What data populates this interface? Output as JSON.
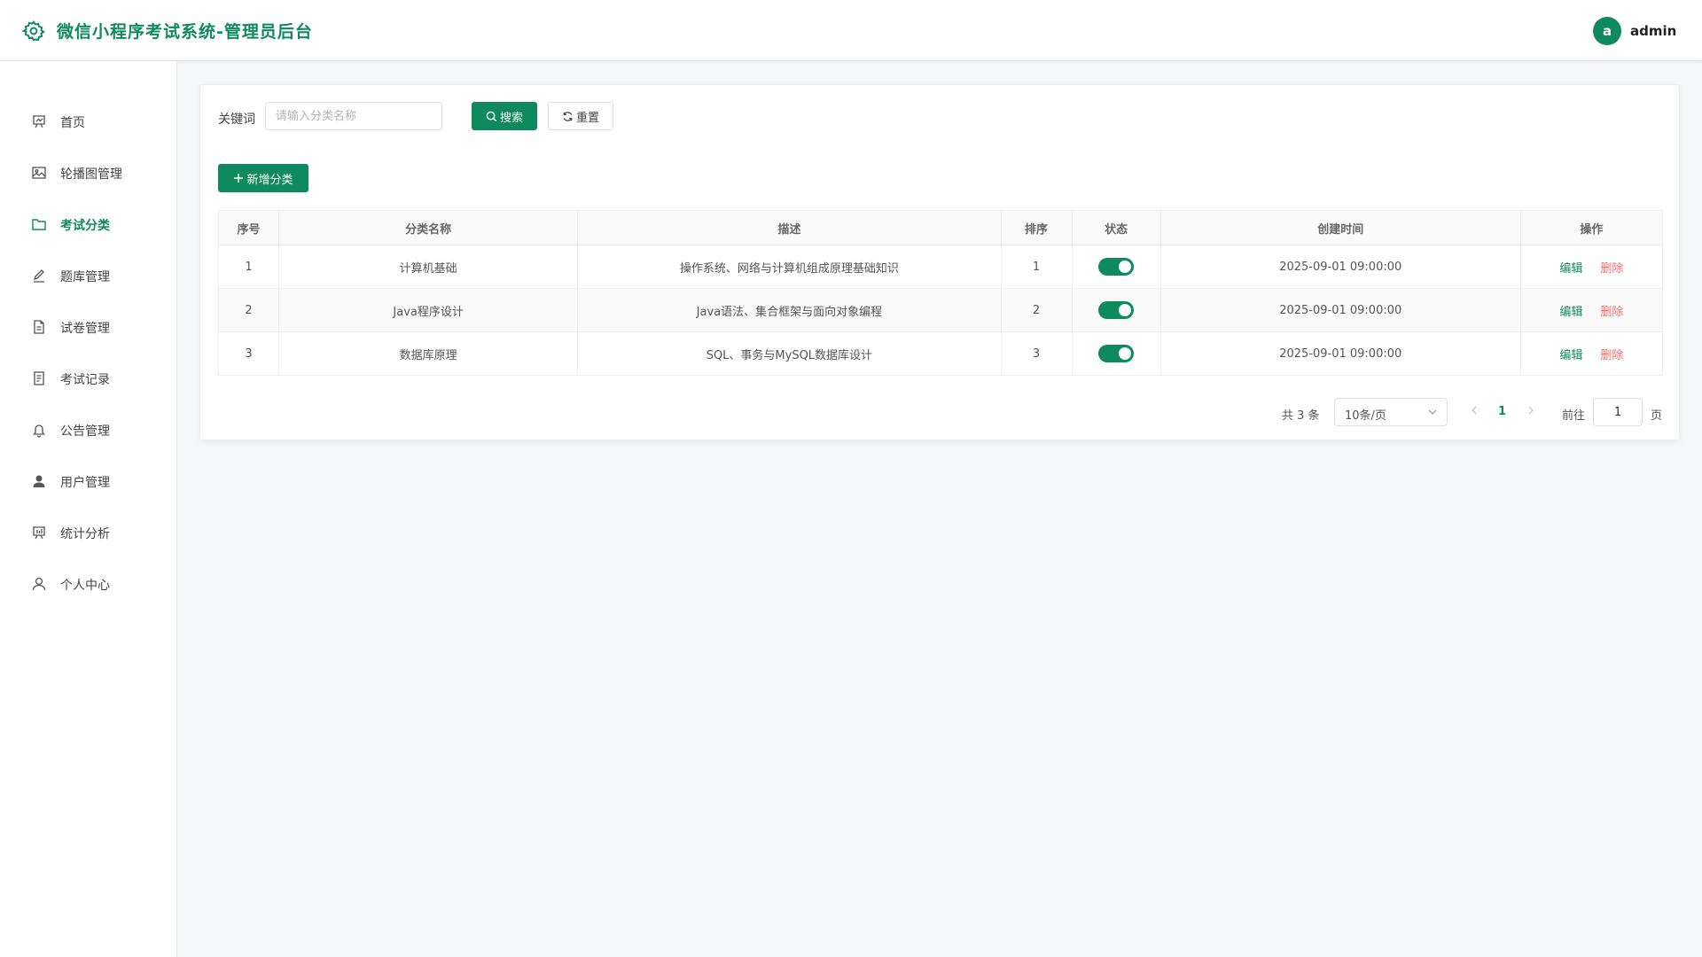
{
  "app": {
    "title": "微信小程序考试系统-管理员后台",
    "user_avatar_letter": "a",
    "username": "admin"
  },
  "colors": {
    "primary": "#0f8a5f",
    "danger": "#f56c6c"
  },
  "sidebar": {
    "items": [
      {
        "label": "首页",
        "icon": "presentation-chart-icon",
        "active": false
      },
      {
        "label": "轮播图管理",
        "icon": "image-icon",
        "active": false
      },
      {
        "label": "考试分类",
        "icon": "folder-icon",
        "active": true
      },
      {
        "label": "题库管理",
        "icon": "edit-pen-icon",
        "active": false
      },
      {
        "label": "试卷管理",
        "icon": "document-icon",
        "active": false
      },
      {
        "label": "考试记录",
        "icon": "tickets-icon",
        "active": false
      },
      {
        "label": "公告管理",
        "icon": "bell-icon",
        "active": false
      },
      {
        "label": "用户管理",
        "icon": "user-filled-icon",
        "active": false
      },
      {
        "label": "统计分析",
        "icon": "data-board-icon",
        "active": false
      },
      {
        "label": "个人中心",
        "icon": "user-icon",
        "active": false
      }
    ]
  },
  "search": {
    "label": "关键词",
    "placeholder": "请输入分类名称",
    "value": "",
    "search_button": "搜索",
    "reset_button": "重置"
  },
  "toolbar": {
    "add_button": "新增分类"
  },
  "table": {
    "columns": [
      "序号",
      "分类名称",
      "描述",
      "排序",
      "状态",
      "创建时间",
      "操作"
    ],
    "rows": [
      {
        "index": "1",
        "name": "计算机基础",
        "description": "操作系统、网络与计算机组成原理基础知识",
        "sort": "1",
        "enabled": true,
        "created_at": "2025-09-01 09:00:00"
      },
      {
        "index": "2",
        "name": "Java程序设计",
        "description": "Java语法、集合框架与面向对象编程",
        "sort": "2",
        "enabled": true,
        "created_at": "2025-09-01 09:00:00"
      },
      {
        "index": "3",
        "name": "数据库原理",
        "description": "SQL、事务与MySQL数据库设计",
        "sort": "3",
        "enabled": true,
        "created_at": "2025-09-01 09:00:00"
      }
    ],
    "edit_label": "编辑",
    "delete_label": "删除"
  },
  "pagination": {
    "total_text": "共 3 条",
    "page_size": "10条/页",
    "current_page": "1",
    "goto_label": "前往",
    "goto_value": "1",
    "page_unit": "页"
  }
}
